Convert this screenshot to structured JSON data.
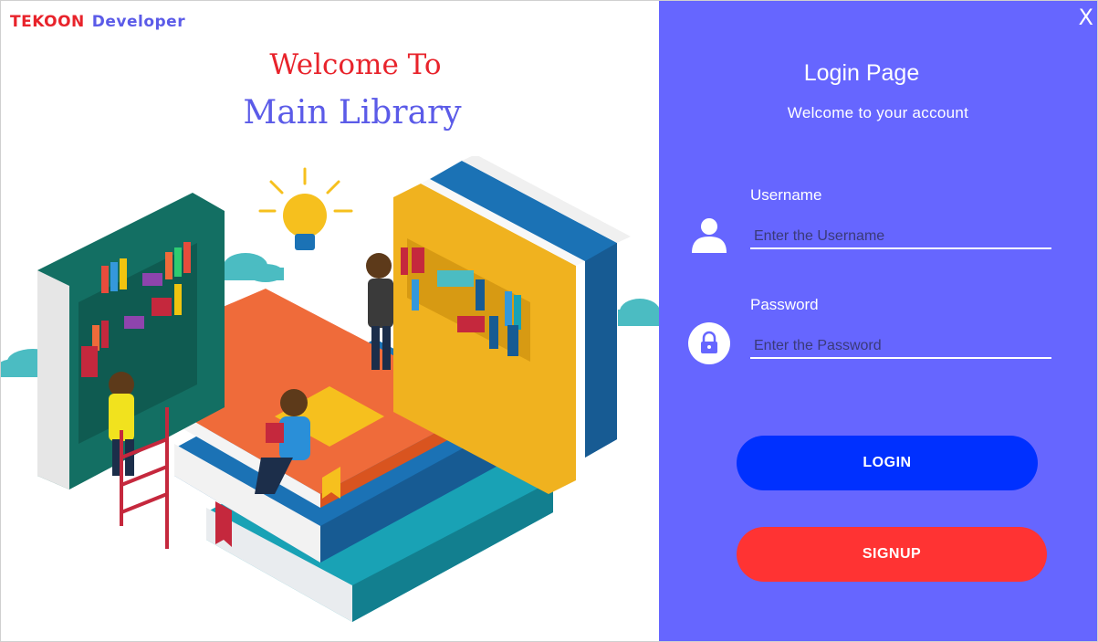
{
  "brand": {
    "primary": "TEKOON",
    "secondary": "Developer"
  },
  "hero": {
    "line1": "Welcome To",
    "line2": "Main Library"
  },
  "login": {
    "title": "Login Page",
    "subtitle": "Welcome to your account",
    "close": "X",
    "username_label": "Username",
    "username_placeholder": "Enter the Username",
    "password_label": "Password",
    "password_placeholder": "Enter the Password",
    "login_button": "LOGIN",
    "signup_button": "SIGNUP"
  },
  "colors": {
    "panel": "#6666ff",
    "brand_red": "#e8232b",
    "brand_blue": "#5b5be8",
    "login_button": "#0030ff",
    "signup_button": "#ff3333"
  },
  "icons": [
    "user-icon",
    "lock-icon",
    "close-icon",
    "library-illustration"
  ]
}
